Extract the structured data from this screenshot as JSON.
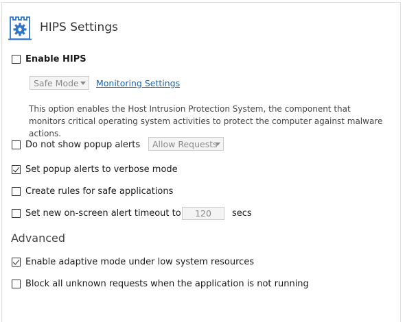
{
  "header": {
    "title": "HIPS Settings",
    "icon": "castle-gear-icon",
    "accent": "#2f74c8"
  },
  "enable_hips": {
    "label": "Enable HIPS",
    "checked": false
  },
  "mode_select": {
    "value": "Safe Mode",
    "enabled": false
  },
  "monitoring_link": "Monitoring Settings",
  "description": "This option enables the Host Intrusion Protection System, the component that monitors critical operating system activities to protect the computer against malware actions.",
  "options": {
    "no_popup": {
      "label": "Do not show popup alerts",
      "checked": false,
      "select_value": "Allow Requests"
    },
    "verbose": {
      "label": "Set popup alerts to verbose mode",
      "checked": true
    },
    "safe_rules": {
      "label": "Create rules for safe applications",
      "checked": false
    },
    "timeout": {
      "label": "Set new on-screen alert timeout to",
      "checked": false,
      "value": "120",
      "unit": "secs"
    }
  },
  "advanced": {
    "title": "Advanced",
    "adaptive": {
      "label": "Enable adaptive mode under low system resources",
      "checked": true
    },
    "block_unknown": {
      "label": "Block all unknown requests when the application is not running",
      "checked": false
    }
  }
}
